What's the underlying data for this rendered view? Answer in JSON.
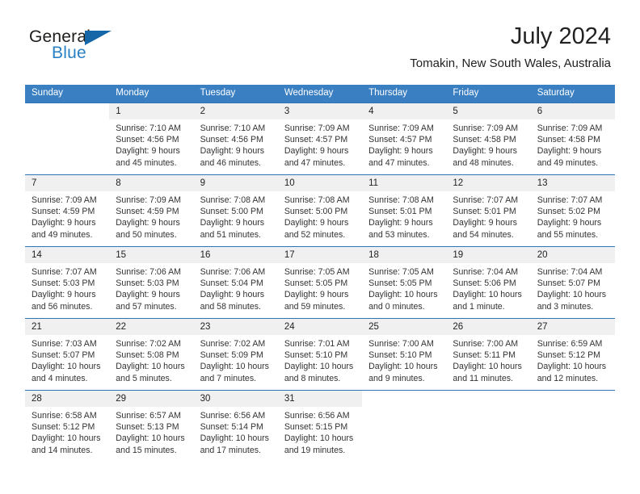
{
  "brand": {
    "name_part1": "General",
    "name_part2": "Blue",
    "flag_icon": "triangle-flag-icon"
  },
  "header": {
    "title": "July 2024",
    "location": "Tomakin, New South Wales, Australia"
  },
  "colors": {
    "header_blue": "#3a7fc1",
    "rule_blue": "#2f74b5",
    "daynum_bg": "#f0f0f0",
    "brand_blue": "#2980c4",
    "brand_flag": "#1567a8",
    "text": "#333333"
  },
  "calendar": {
    "weekday_headers": [
      "Sunday",
      "Monday",
      "Tuesday",
      "Wednesday",
      "Thursday",
      "Friday",
      "Saturday"
    ],
    "weeks": [
      [
        {
          "day": "",
          "info": "",
          "blank": true
        },
        {
          "day": "1",
          "info": "Sunrise: 7:10 AM\nSunset: 4:56 PM\nDaylight: 9 hours\nand 45 minutes."
        },
        {
          "day": "2",
          "info": "Sunrise: 7:10 AM\nSunset: 4:56 PM\nDaylight: 9 hours\nand 46 minutes."
        },
        {
          "day": "3",
          "info": "Sunrise: 7:09 AM\nSunset: 4:57 PM\nDaylight: 9 hours\nand 47 minutes."
        },
        {
          "day": "4",
          "info": "Sunrise: 7:09 AM\nSunset: 4:57 PM\nDaylight: 9 hours\nand 47 minutes."
        },
        {
          "day": "5",
          "info": "Sunrise: 7:09 AM\nSunset: 4:58 PM\nDaylight: 9 hours\nand 48 minutes."
        },
        {
          "day": "6",
          "info": "Sunrise: 7:09 AM\nSunset: 4:58 PM\nDaylight: 9 hours\nand 49 minutes."
        }
      ],
      [
        {
          "day": "7",
          "info": "Sunrise: 7:09 AM\nSunset: 4:59 PM\nDaylight: 9 hours\nand 49 minutes."
        },
        {
          "day": "8",
          "info": "Sunrise: 7:09 AM\nSunset: 4:59 PM\nDaylight: 9 hours\nand 50 minutes."
        },
        {
          "day": "9",
          "info": "Sunrise: 7:08 AM\nSunset: 5:00 PM\nDaylight: 9 hours\nand 51 minutes."
        },
        {
          "day": "10",
          "info": "Sunrise: 7:08 AM\nSunset: 5:00 PM\nDaylight: 9 hours\nand 52 minutes."
        },
        {
          "day": "11",
          "info": "Sunrise: 7:08 AM\nSunset: 5:01 PM\nDaylight: 9 hours\nand 53 minutes."
        },
        {
          "day": "12",
          "info": "Sunrise: 7:07 AM\nSunset: 5:01 PM\nDaylight: 9 hours\nand 54 minutes."
        },
        {
          "day": "13",
          "info": "Sunrise: 7:07 AM\nSunset: 5:02 PM\nDaylight: 9 hours\nand 55 minutes."
        }
      ],
      [
        {
          "day": "14",
          "info": "Sunrise: 7:07 AM\nSunset: 5:03 PM\nDaylight: 9 hours\nand 56 minutes."
        },
        {
          "day": "15",
          "info": "Sunrise: 7:06 AM\nSunset: 5:03 PM\nDaylight: 9 hours\nand 57 minutes."
        },
        {
          "day": "16",
          "info": "Sunrise: 7:06 AM\nSunset: 5:04 PM\nDaylight: 9 hours\nand 58 minutes."
        },
        {
          "day": "17",
          "info": "Sunrise: 7:05 AM\nSunset: 5:05 PM\nDaylight: 9 hours\nand 59 minutes."
        },
        {
          "day": "18",
          "info": "Sunrise: 7:05 AM\nSunset: 5:05 PM\nDaylight: 10 hours\nand 0 minutes."
        },
        {
          "day": "19",
          "info": "Sunrise: 7:04 AM\nSunset: 5:06 PM\nDaylight: 10 hours\nand 1 minute."
        },
        {
          "day": "20",
          "info": "Sunrise: 7:04 AM\nSunset: 5:07 PM\nDaylight: 10 hours\nand 3 minutes."
        }
      ],
      [
        {
          "day": "21",
          "info": "Sunrise: 7:03 AM\nSunset: 5:07 PM\nDaylight: 10 hours\nand 4 minutes."
        },
        {
          "day": "22",
          "info": "Sunrise: 7:02 AM\nSunset: 5:08 PM\nDaylight: 10 hours\nand 5 minutes."
        },
        {
          "day": "23",
          "info": "Sunrise: 7:02 AM\nSunset: 5:09 PM\nDaylight: 10 hours\nand 7 minutes."
        },
        {
          "day": "24",
          "info": "Sunrise: 7:01 AM\nSunset: 5:10 PM\nDaylight: 10 hours\nand 8 minutes."
        },
        {
          "day": "25",
          "info": "Sunrise: 7:00 AM\nSunset: 5:10 PM\nDaylight: 10 hours\nand 9 minutes."
        },
        {
          "day": "26",
          "info": "Sunrise: 7:00 AM\nSunset: 5:11 PM\nDaylight: 10 hours\nand 11 minutes."
        },
        {
          "day": "27",
          "info": "Sunrise: 6:59 AM\nSunset: 5:12 PM\nDaylight: 10 hours\nand 12 minutes."
        }
      ],
      [
        {
          "day": "28",
          "info": "Sunrise: 6:58 AM\nSunset: 5:12 PM\nDaylight: 10 hours\nand 14 minutes."
        },
        {
          "day": "29",
          "info": "Sunrise: 6:57 AM\nSunset: 5:13 PM\nDaylight: 10 hours\nand 15 minutes."
        },
        {
          "day": "30",
          "info": "Sunrise: 6:56 AM\nSunset: 5:14 PM\nDaylight: 10 hours\nand 17 minutes."
        },
        {
          "day": "31",
          "info": "Sunrise: 6:56 AM\nSunset: 5:15 PM\nDaylight: 10 hours\nand 19 minutes."
        },
        {
          "day": "",
          "info": "",
          "blank": true
        },
        {
          "day": "",
          "info": "",
          "blank": true
        },
        {
          "day": "",
          "info": "",
          "blank": true
        }
      ]
    ]
  }
}
